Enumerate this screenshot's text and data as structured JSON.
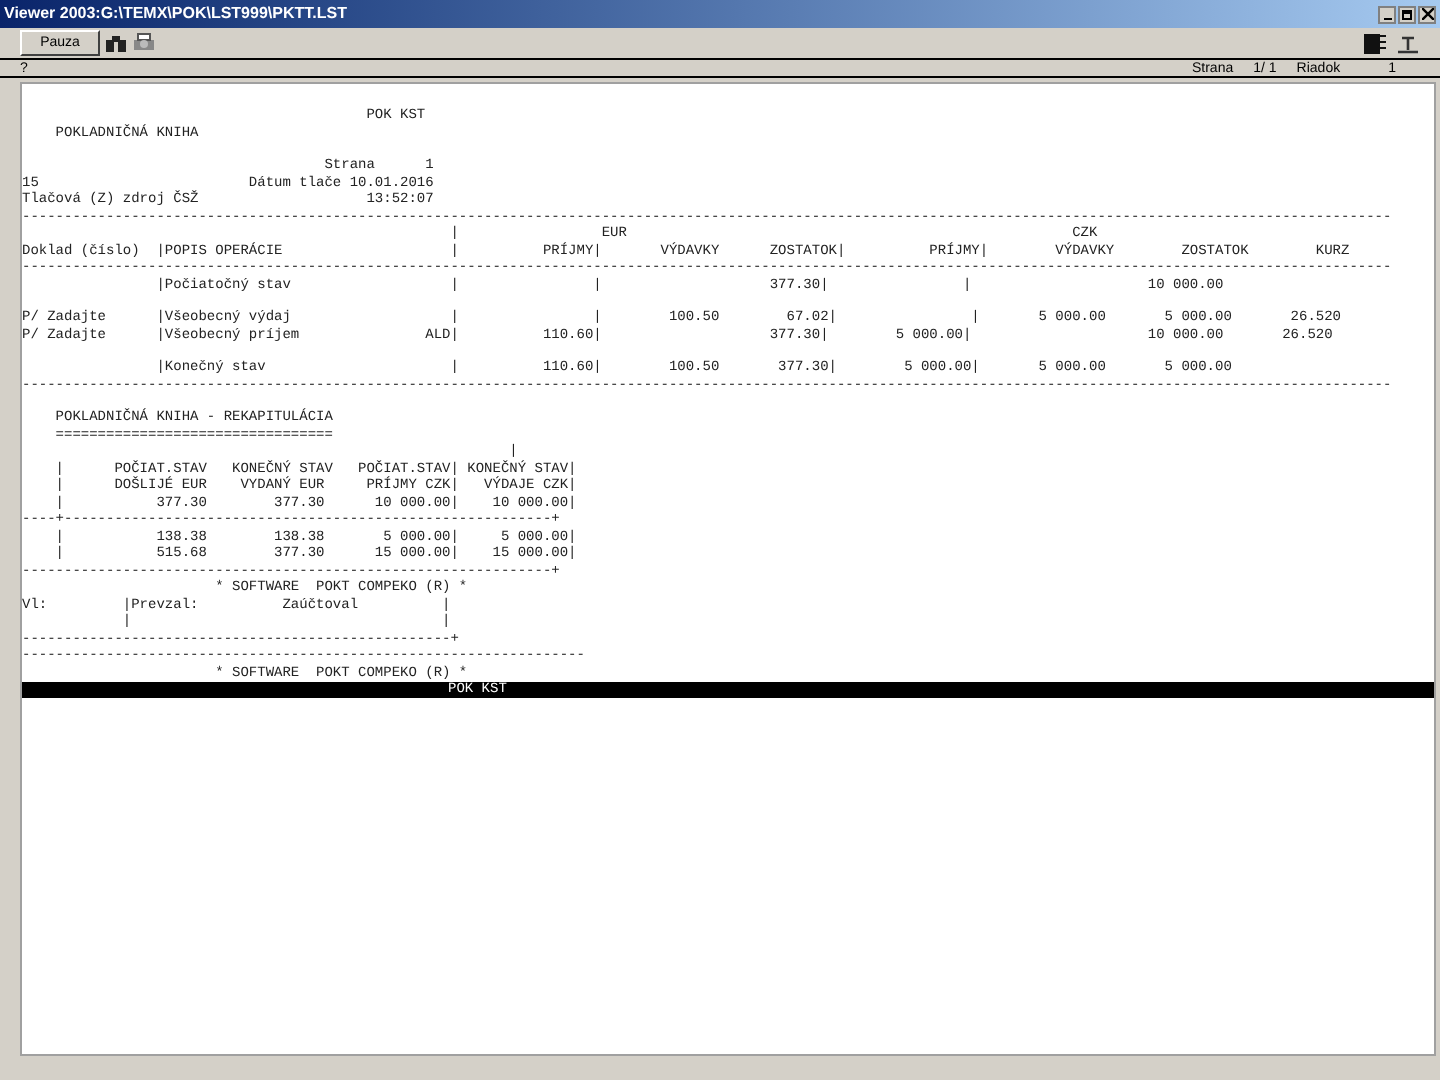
{
  "window": {
    "title": "Viewer 2003:G:\\TEMX\\POK\\LST999\\PKTT.LST"
  },
  "toolbar": {
    "button": "Pauza"
  },
  "status_bar": {
    "left": "?",
    "page_label": "Strana",
    "page": "1/ 1",
    "line_label": "Riadok",
    "line": "1"
  },
  "report": {
    "sections": [
      [
        "                                         POK KST",
        "    POKLADNIČNÁ KNIHA"
      ],
      [
        "                                    Strana      1",
        "15                         Dátum tlače 10.01.2016",
        "Tlačová (Z) zdroj ČSŽ                    13:52:07",
        "-------------------------------------------------------------------------------------------------------------------------------------------------------------------",
        "                                                   |                 EUR                                                     CZK",
        "Doklad (číslo)  |POPIS OPERÁCIE                    |          PRÍJMY|       VÝDAVKY      ZOSTATOK|          PRÍJMY|        VÝDAVKY        ZOSTATOK        KURZ",
        "-------------------------------------------------------------------------------------------------------------------------------------------------------------------",
        "                |Počiatočný stav                   |                |                    377.30|                |                     10 000.00"
      ],
      [
        "P/ Zadajte      |Všeobecný výdaj                   |                |        100.50        67.02|                |       5 000.00       5 000.00       26.520",
        "P/ Zadajte      |Všeobecný príjem               ALD|          110.60|                    377.30|        5 000.00|                     10 000.00       26.520"
      ],
      [
        "                |Konečný stav                      |          110.60|        100.50       377.30|        5 000.00|       5 000.00       5 000.00",
        "-------------------------------------------------------------------------------------------------------------------------------------------------------------------"
      ],
      [
        "    POKLADNIČNÁ KNIHA - REKAPITULÁCIA",
        "    =================================",
        "                                                          |",
        "    |      POČIAT.STAV   KONEČNÝ STAV   POČIAT.STAV| KONEČNÝ STAV|",
        "    |      DOŠLIJÉ EUR    VYDANÝ EUR     PRÍJMY CZK|   VÝDAJE CZK|",
        "    |           377.30        377.30      10 000.00|    10 000.00|",
        "----+----------------------------------------------------------+",
        "    |           138.38        138.38       5 000.00|     5 000.00|",
        "    |           515.68        377.30      15 000.00|    15 000.00|",
        "---------------------------------------------------------------+",
        "                       * SOFTWARE  POKT COMPEKO (R) *",
        "Vl:         |Prevzal:          Zaúčtoval          |",
        "            |                                     |",
        "---------------------------------------------------+",
        "-------------------------------------------------------------------",
        "                       * SOFTWARE  POKT COMPEKO (R) *"
      ]
    ]
  },
  "footer_bar": {
    "text": "POK KST"
  }
}
